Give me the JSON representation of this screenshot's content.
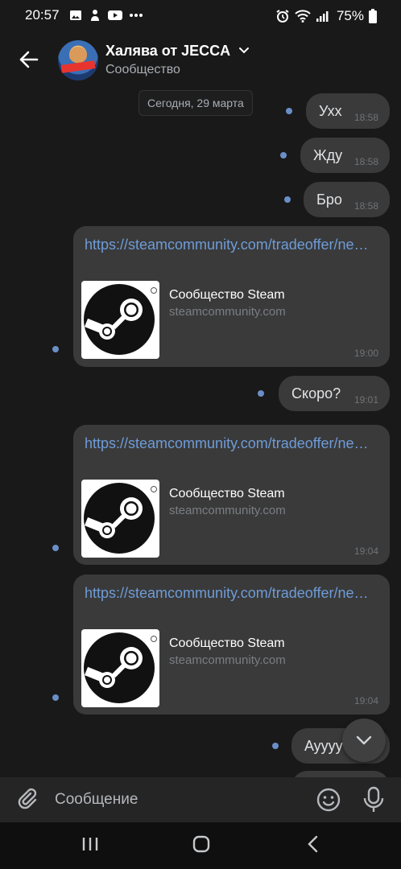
{
  "status_bar": {
    "time": "20:57",
    "battery": "75%",
    "icons_left": [
      "gallery-icon",
      "notification-icon",
      "youtube-icon",
      "more-dots-icon"
    ],
    "icons_right": [
      "alarm-icon",
      "wifi-icon",
      "signal-icon",
      "battery-icon"
    ]
  },
  "header": {
    "title": "Халява от JECCA",
    "subtitle": "Сообщество"
  },
  "date_separator": "Сегодня, 29 марта",
  "messages": [
    {
      "type": "text",
      "text": "Ухх",
      "time": "18:58"
    },
    {
      "type": "text",
      "text": "Жду",
      "time": "18:58"
    },
    {
      "type": "text",
      "text": "Бро",
      "time": "18:58"
    },
    {
      "type": "link",
      "url": "https://steamcommunity.com/tradeoffer/ne…",
      "snippet_title": "Сообщество Steam",
      "snippet_domain": "steamcommunity.com",
      "time": "19:00"
    },
    {
      "type": "text",
      "text": "Скоро?",
      "time": "19:01"
    },
    {
      "type": "link",
      "url": "https://steamcommunity.com/tradeoffer/ne…",
      "snippet_title": "Сообщество Steam",
      "snippet_domain": "steamcommunity.com",
      "time": "19:04"
    },
    {
      "type": "link",
      "url": "https://steamcommunity.com/tradeoffer/ne…",
      "snippet_title": "Сообщество Steam",
      "snippet_domain": "steamcommunity.com",
      "time": "19:04"
    },
    {
      "type": "text",
      "text": "Ayyyy",
      "time": ""
    }
  ],
  "composer": {
    "placeholder": "Сообщение"
  },
  "colors": {
    "background": "#191919",
    "bubble": "#3a3a3a",
    "link": "#6e9cd8",
    "unread_dot": "#6a8fc7"
  }
}
